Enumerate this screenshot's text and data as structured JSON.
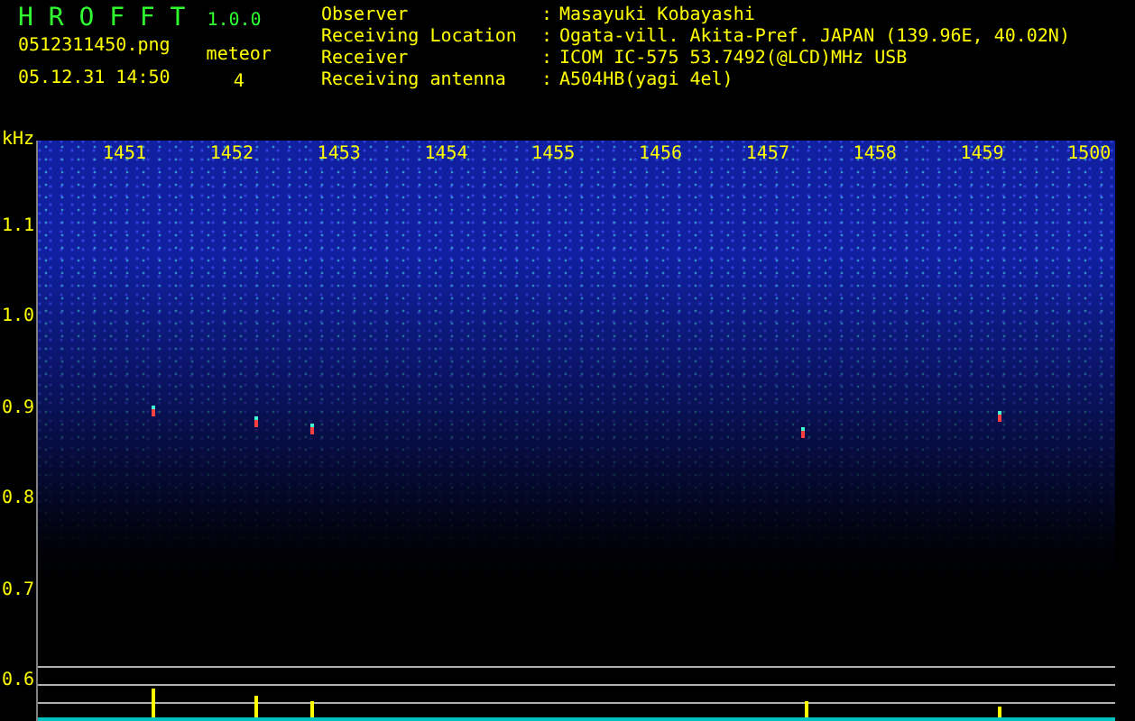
{
  "app": {
    "name": "H R O F F T",
    "version": "1.0.0",
    "filename": "0512311450.png",
    "timestamp": "05.12.31 14:50",
    "meteor_label": "meteor",
    "meteor_count": "4"
  },
  "info": [
    {
      "label": "Observer",
      "separator": ":",
      "value": "Masayuki Kobayashi"
    },
    {
      "label": "Receiving Location",
      "separator": ":",
      "value": "Ogata-vill. Akita-Pref. JAPAN (139.96E, 40.02N)"
    },
    {
      "label": "Receiver",
      "separator": ":",
      "value": "ICOM IC-575 53.7492(@LCD)MHz USB"
    },
    {
      "label": "Receiving antenna",
      "separator": ":",
      "value": "A504HB(yagi 4el)"
    }
  ],
  "plot": {
    "unit": "kHz",
    "y_ticks": [
      "1.1",
      "1.0",
      "0.9",
      "0.8",
      "0.7",
      "0.6"
    ],
    "x_ticks": [
      "1451",
      "1452",
      "1453",
      "1454",
      "1455",
      "1456",
      "1457",
      "1458",
      "1459",
      "1500"
    ]
  }
}
